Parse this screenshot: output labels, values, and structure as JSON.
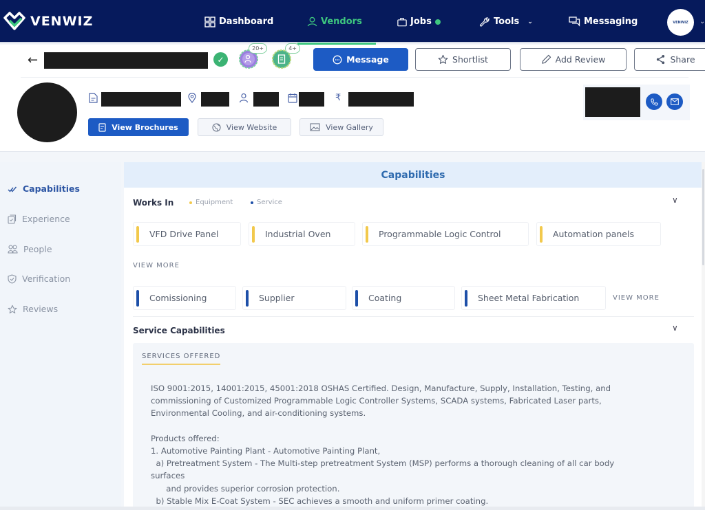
{
  "nav": {
    "brand": "VENWIZ",
    "items": [
      {
        "label": "Dashboard",
        "icon": "grid-icon",
        "active": false
      },
      {
        "label": "Vendors",
        "icon": "user-icon",
        "active": true
      },
      {
        "label": "Jobs",
        "icon": "briefcase-icon",
        "active": false,
        "indicator": true
      },
      {
        "label": "Tools",
        "icon": "wrench-icon",
        "active": false,
        "dropdown": true
      },
      {
        "label": "Messaging",
        "icon": "chat-icon",
        "active": false
      }
    ],
    "avatar_text": "VENWIZ"
  },
  "header": {
    "back_icon": "arrow-left-icon",
    "badges": [
      {
        "icon": "people-badge-icon",
        "count": "20+"
      },
      {
        "icon": "document-badge-icon",
        "count": "4+"
      }
    ],
    "actions": {
      "message": "Message",
      "shortlist": "Shortlist",
      "add_review": "Add Review",
      "share": "Share"
    },
    "links": {
      "brochures": "View Brochures",
      "website": "View Website",
      "gallery": "View Gallery"
    }
  },
  "sidebar": {
    "items": [
      {
        "label": "Capabilities",
        "active": true
      },
      {
        "label": "Experience",
        "active": false
      },
      {
        "label": "People",
        "active": false
      },
      {
        "label": "Verification",
        "active": false
      },
      {
        "label": "Reviews",
        "active": false
      }
    ]
  },
  "main": {
    "title": "Capabilities",
    "works_in": {
      "label": "Works In",
      "legend": [
        {
          "label": "Equipment",
          "color": "#f2c94c"
        },
        {
          "label": "Service",
          "color": "#1d4fa8"
        }
      ],
      "equipment": [
        "VFD Drive Panel",
        "Industrial Oven",
        "Programmable Logic Control",
        "Automation panels"
      ],
      "services": [
        "Comissioning",
        "Supplier",
        "Coating",
        "Sheet Metal Fabrication"
      ],
      "view_more": "VIEW MORE"
    },
    "service_capabilities": {
      "label": "Service Capabilities",
      "section_heading": "SERVICES OFFERED",
      "text": "ISO 9001:2015, 14001:2015, 45001:2018 OSHAS Certified. Design, Manufacture, Supply, Installation, Testing, and\ncommissioning of Customized Programmable Logic Controller Systems, SCADA systems, Fabricated Laser parts,\nEnvironmental Cooling, and air-conditioning systems.\n\nProducts offered:\n1. Automotive Painting Plant - Automotive Painting Plant,\n  a) Pretreatment System - The Multi-step pretreatment System (MSP) performs a thorough cleaning of all car body\nsurfaces\n      and provides superior corrosion protection.\n  b) Stable Mix E-Coat System - SEC achieves a smooth and uniform primer coating."
    }
  },
  "colors": {
    "nav_bg": "#061a5c",
    "accent_green": "#3ec77f",
    "primary_blue": "#1d5bc4",
    "equipment_yellow": "#f2c94c",
    "service_blue": "#1d4fa8"
  }
}
